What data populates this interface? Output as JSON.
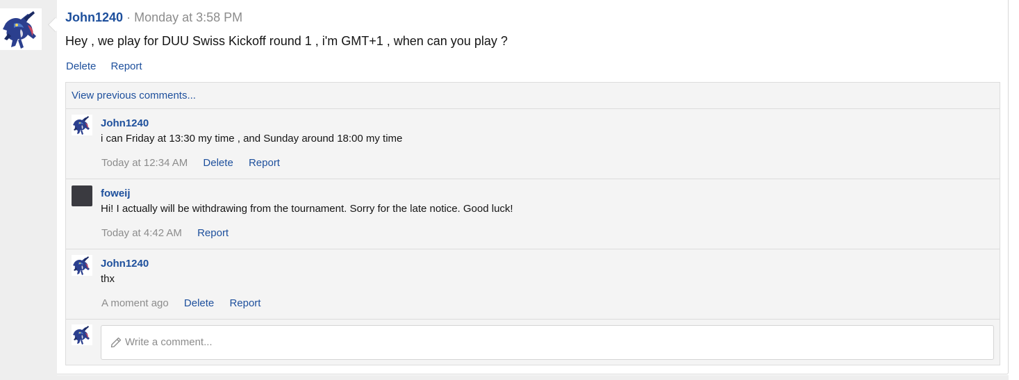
{
  "post": {
    "author": "John1240",
    "separator": "·",
    "time": "Monday at 3:58 PM",
    "body": "Hey , we play for DUU Swiss Kickoff round 1 , i'm GMT+1 , when can you play ?",
    "actions": {
      "delete": "Delete",
      "report": "Report"
    }
  },
  "comments": {
    "view_previous": "View previous comments...",
    "items": [
      {
        "author": "John1240",
        "text": "i can Friday at 13:30 my time , and Sunday around 18:00 my time",
        "time": "Today at 12:34 AM",
        "delete": "Delete",
        "report": "Report"
      },
      {
        "author": "foweij",
        "text": "Hi! I actually will be withdrawing from the tournament. Sorry for the late notice. Good luck!",
        "time": "Today at 4:42 AM",
        "report": "Report"
      },
      {
        "author": "John1240",
        "text": "thx",
        "time": "A moment ago",
        "delete": "Delete",
        "report": "Report"
      }
    ],
    "write_placeholder": "Write a comment..."
  },
  "colors": {
    "link": "#1d4f9c",
    "muted": "#8c8c8c",
    "panel": "#f4f4f4",
    "gutter": "#eeeeee"
  },
  "icons": {
    "avatar": "character-avatar-icon",
    "compose": "pencil-icon"
  }
}
